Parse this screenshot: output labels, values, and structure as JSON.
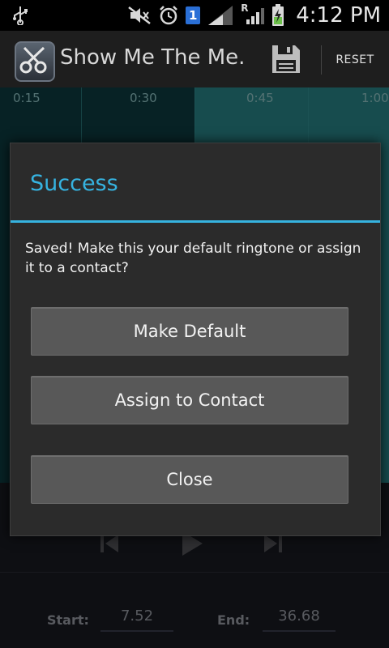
{
  "status_bar": {
    "time": "4:12 PM",
    "sim_slot": "1",
    "roaming_indicator": "R",
    "icons": [
      "usb-icon",
      "mute-icon",
      "alarm-icon",
      "sim-icon",
      "signal-icon",
      "roaming-signal-icon",
      "battery-charging-icon"
    ]
  },
  "action_bar": {
    "title": "Show Me The Me...",
    "save_icon": "save-icon",
    "reset_label": "RESET"
  },
  "timeline": {
    "ticks": [
      "0:15",
      "0:30",
      "0:45",
      "1:00"
    ]
  },
  "lower": {
    "start_label": "Start:",
    "start_value": "7.52",
    "end_label": "End:",
    "end_value": "36.68"
  },
  "dialog": {
    "title": "Success",
    "message": "Saved! Make this your default ringtone or assign it to a contact?",
    "buttons": {
      "make_default": "Make Default",
      "assign_contact": "Assign to Contact",
      "close": "Close"
    }
  },
  "colors": {
    "accent": "#36b3e0",
    "wave_dark": "#0e3f44",
    "wave_selected": "#2a8a8e",
    "button_bg": "#585858",
    "dialog_bg": "#2b2b2b"
  }
}
